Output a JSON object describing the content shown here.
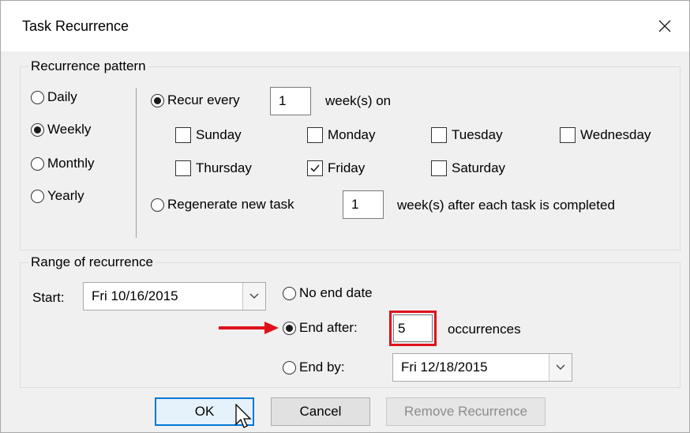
{
  "window": {
    "title": "Task Recurrence",
    "close_icon": "close-icon"
  },
  "pattern": {
    "group_label": "Recurrence pattern",
    "frequencies": [
      {
        "label": "Daily",
        "selected": false
      },
      {
        "label": "Weekly",
        "selected": true
      },
      {
        "label": "Monthly",
        "selected": false
      },
      {
        "label": "Yearly",
        "selected": false
      }
    ],
    "recur_every": {
      "label": "Recur every",
      "value": "1",
      "suffix": "week(s) on",
      "selected": true
    },
    "days": [
      {
        "label": "Sunday",
        "checked": false
      },
      {
        "label": "Monday",
        "checked": false
      },
      {
        "label": "Tuesday",
        "checked": false
      },
      {
        "label": "Wednesday",
        "checked": false
      },
      {
        "label": "Thursday",
        "checked": false
      },
      {
        "label": "Friday",
        "checked": true
      },
      {
        "label": "Saturday",
        "checked": false
      }
    ],
    "regenerate": {
      "label": "Regenerate new task",
      "value": "1",
      "suffix": "week(s) after each task is completed",
      "selected": false
    }
  },
  "range": {
    "group_label": "Range of recurrence",
    "start_label": "Start:",
    "start_value": "Fri 10/16/2015",
    "no_end": {
      "label": "No end date",
      "selected": false
    },
    "end_after": {
      "label": "End after:",
      "value": "5",
      "suffix": "occurrences",
      "selected": true
    },
    "end_by": {
      "label": "End by:",
      "value": "Fri 12/18/2015",
      "selected": false
    },
    "highlight_color": "#e0111a",
    "arrow_color": "#e0111a"
  },
  "buttons": {
    "ok": "OK",
    "cancel": "Cancel",
    "remove": "Remove Recurrence"
  }
}
